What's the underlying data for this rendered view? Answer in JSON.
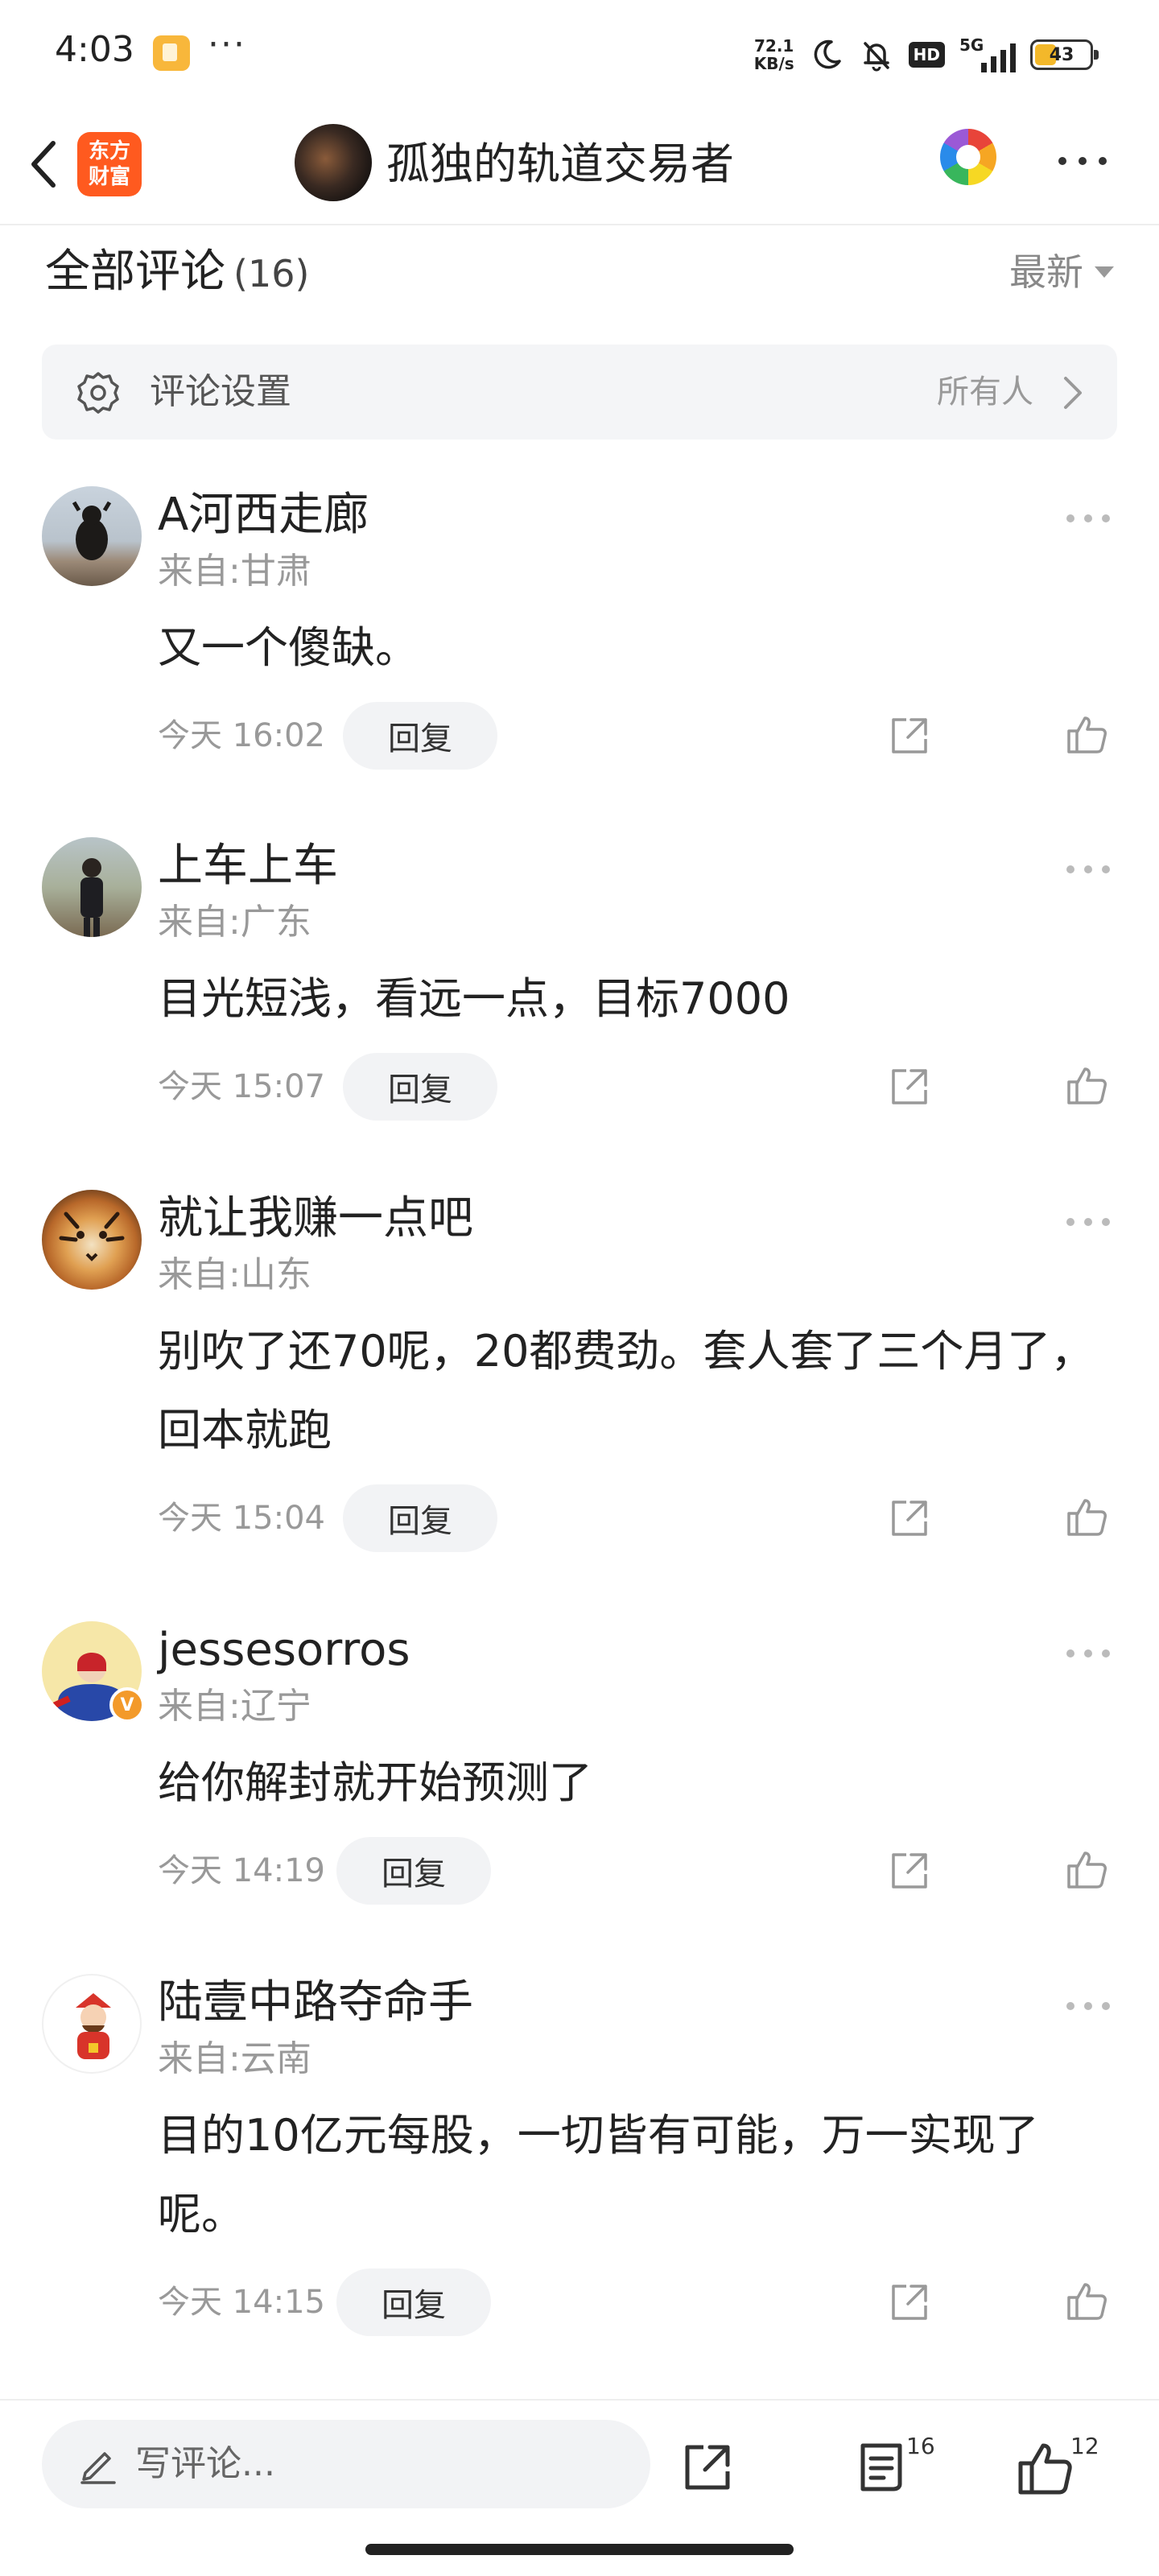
{
  "status_bar": {
    "time": "4:03",
    "dots": "···",
    "speed_value": "72.1",
    "speed_unit": "KB/s",
    "hd_label": "HD",
    "network_label": "5G",
    "battery_level": "43"
  },
  "nav": {
    "logo_line1": "东方",
    "logo_line2": "财富",
    "title": "孤独的轨道交易者"
  },
  "comments_header": {
    "title": "全部评论",
    "count": "(16)",
    "sort": "最新"
  },
  "settings": {
    "label": "评论设置",
    "value": "所有人"
  },
  "comments": [
    {
      "name": "A河西走廊",
      "location": "来自:甘肃",
      "text": "又一个傻缺。",
      "time": "今天 16:02",
      "reply": "回复"
    },
    {
      "name": "上车上车",
      "location": "来自:广东",
      "text": "目光短浅，看远一点，目标7000",
      "time": "今天 15:07",
      "reply": "回复"
    },
    {
      "name": "就让我赚一点吧",
      "location": "来自:山东",
      "text": "别吹了还70呢，20都费劲。套人套了三个月了，回本就跑",
      "time": "今天 15:04",
      "reply": "回复"
    },
    {
      "name": "jessesorros",
      "location": "来自:辽宁",
      "text": "给你解封就开始预测了",
      "time": "今天 14:19",
      "reply": "回复",
      "verified_badge": "V"
    },
    {
      "name": "陆壹中路夺命手",
      "location": "来自:云南",
      "text": "目的10亿元每股，一切皆有可能，万一实现了呢。",
      "time": "今天 14:15",
      "reply": "回复"
    }
  ],
  "bottom_bar": {
    "write_placeholder": "写评论...",
    "comment_count": "16",
    "like_count": "12"
  },
  "colors": {
    "brand": "#ff5a1f",
    "text": "#222222",
    "muted": "#999999",
    "pill_bg": "#f2f3f5"
  },
  "icons": [
    "back-icon",
    "search-icon",
    "gear-icon",
    "chevron-right-icon",
    "more-icon",
    "share-icon",
    "thumb-up-icon",
    "pen-icon",
    "list-icon"
  ]
}
